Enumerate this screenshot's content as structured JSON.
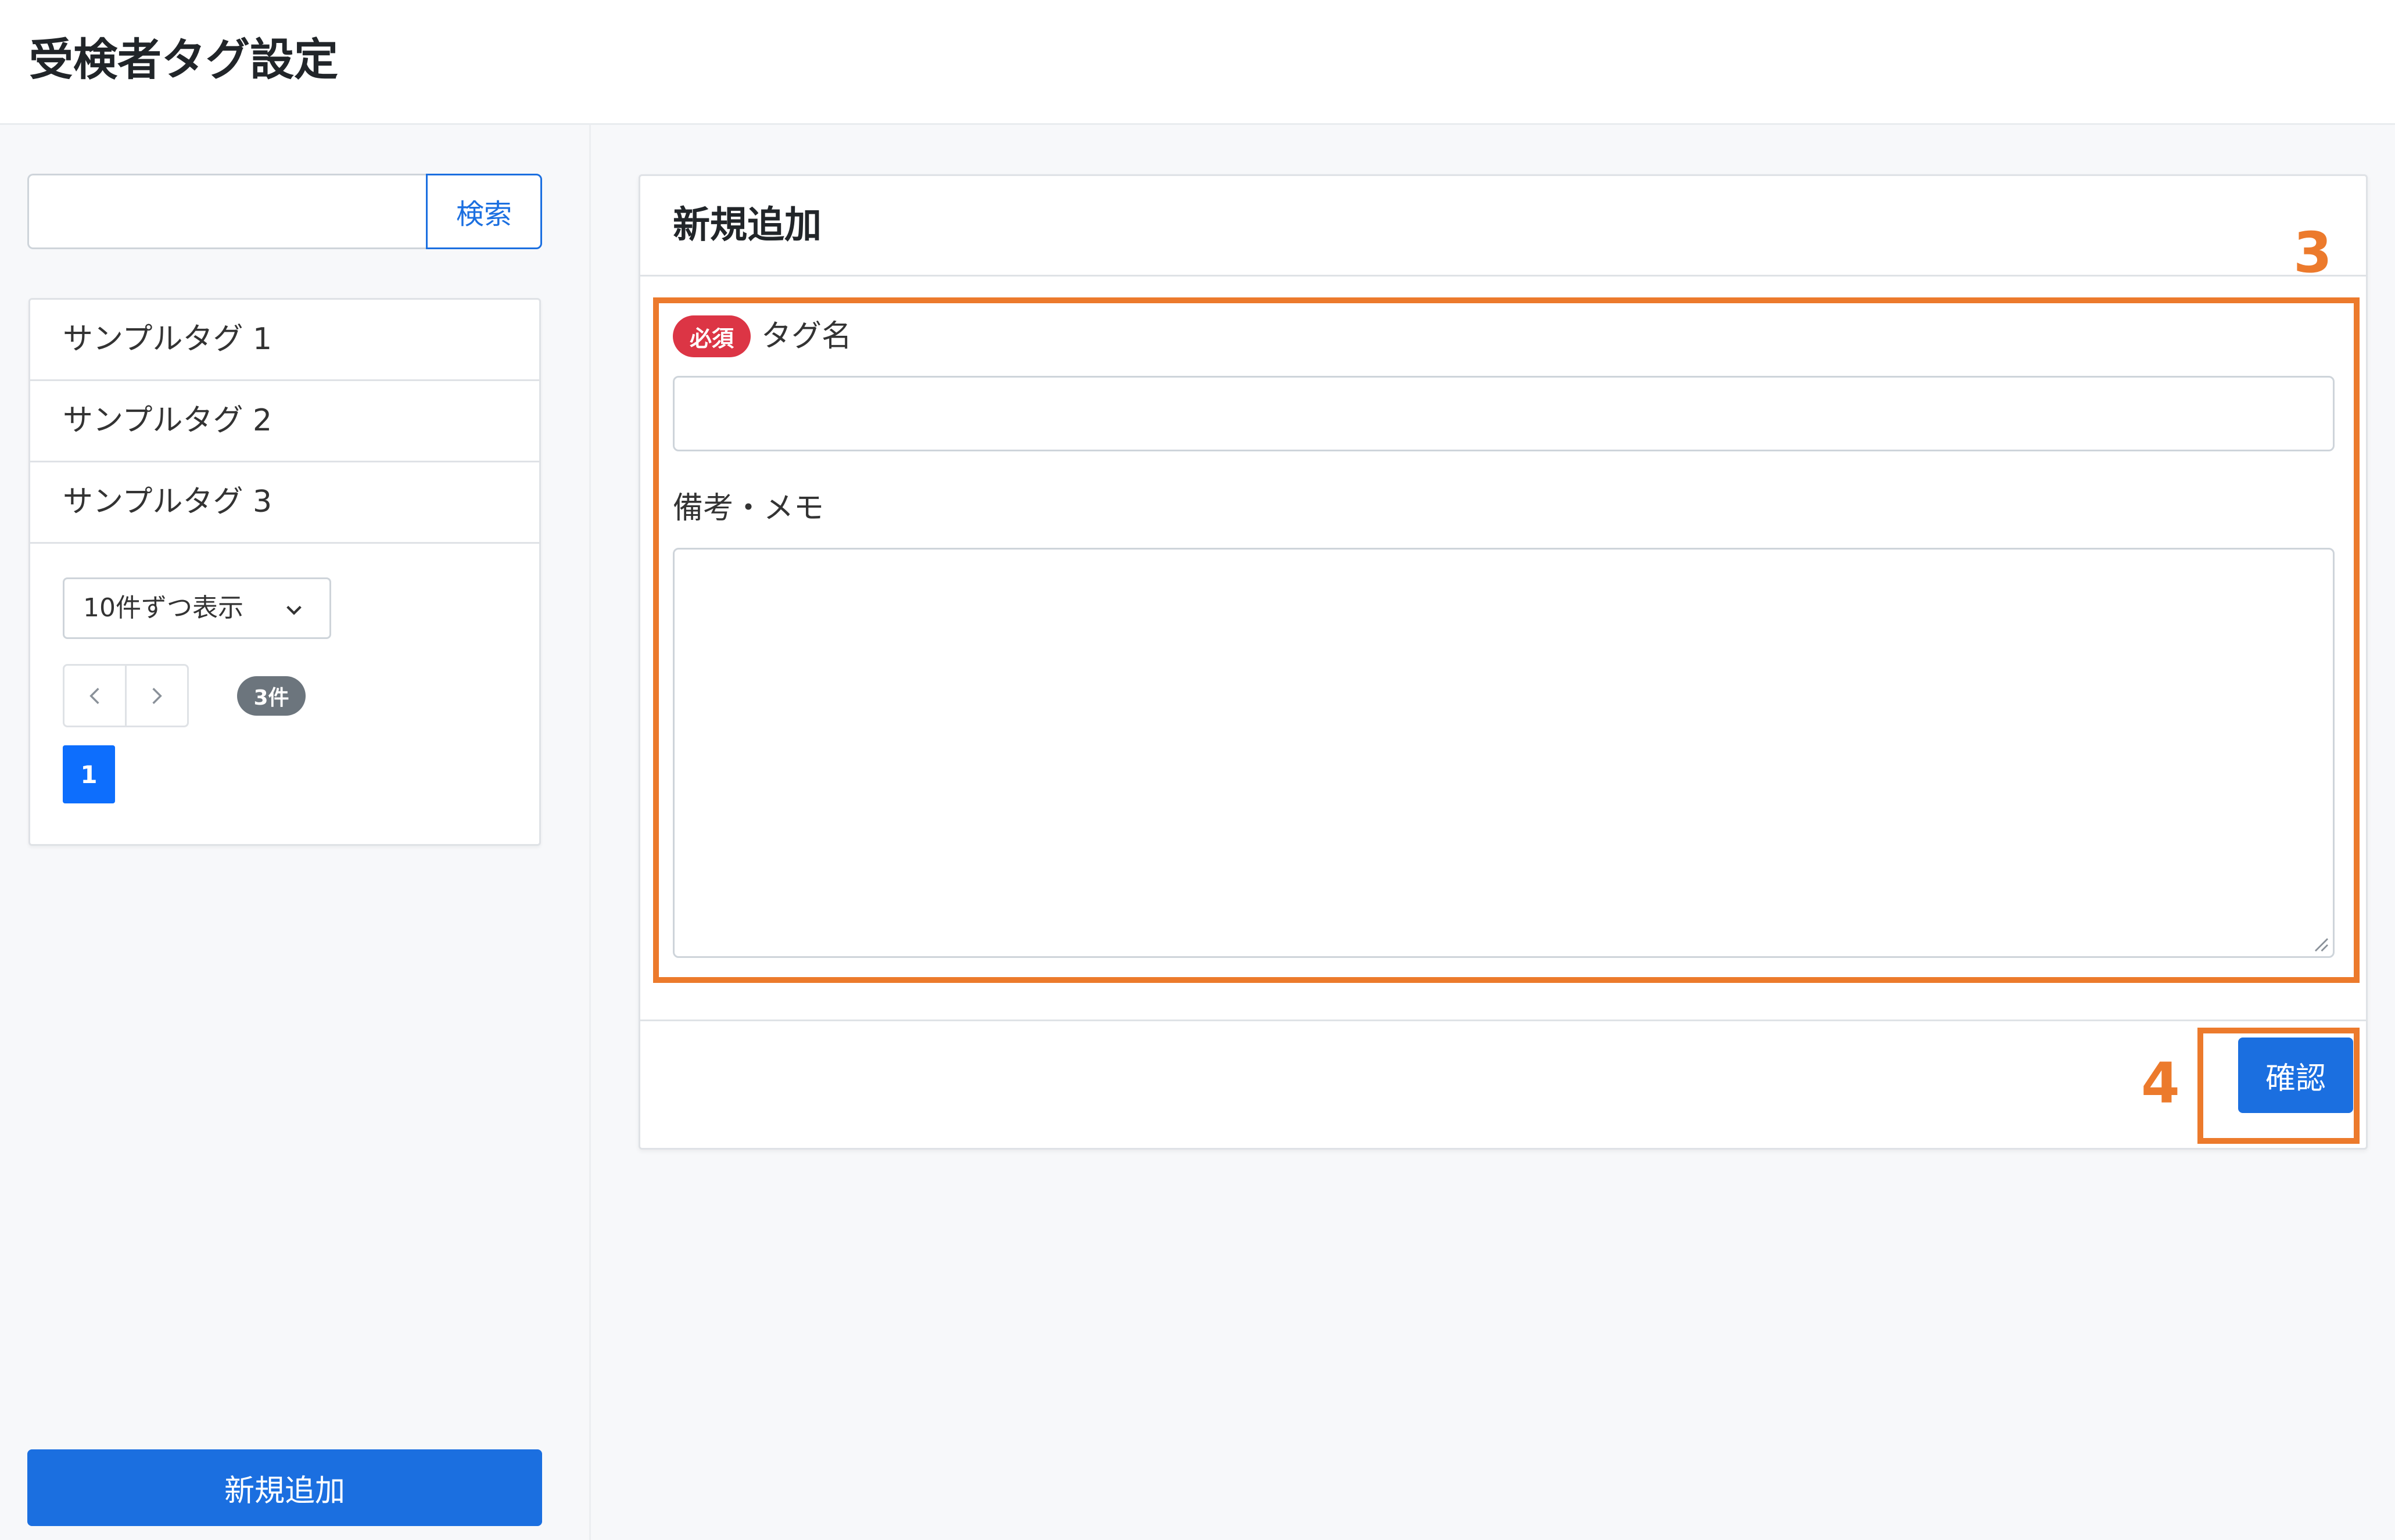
{
  "header": {
    "title": "受検者タグ設定"
  },
  "sidebar": {
    "search": {
      "button_label": "検索",
      "value": "",
      "placeholder": ""
    },
    "tags": [
      {
        "label": "サンプルタグ 1"
      },
      {
        "label": "サンプルタグ 2"
      },
      {
        "label": "サンプルタグ 3"
      }
    ],
    "page_size_select": {
      "selected": "10件ずつ表示"
    },
    "pager": {
      "prev": "‹",
      "next": "›"
    },
    "count_badge": "3件",
    "current_page": "1",
    "add_new_label": "新規追加"
  },
  "form": {
    "title": "新規追加",
    "required_badge": "必須",
    "tag_name_label": "タグ名",
    "tag_name_value": "",
    "memo_label": "備考・メモ",
    "memo_value": "",
    "confirm_label": "確認"
  },
  "callouts": [
    {
      "number": "3"
    },
    {
      "number": "4"
    }
  ],
  "colors": {
    "primary": "#1b6fe0",
    "danger": "#dc3545",
    "badge_gray": "#6c757d",
    "callout": "#ec7a2c",
    "page_bg": "#f7f8fa"
  },
  "icons": {
    "select": "chevron-down-icon",
    "prev": "chevron-left-icon",
    "next": "chevron-right-icon",
    "textarea": "resize-handle-icon"
  }
}
